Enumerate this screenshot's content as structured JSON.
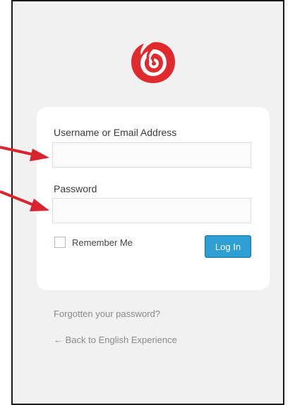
{
  "logo": {
    "icon": "rose-icon",
    "color": "#e02a2e"
  },
  "login_form": {
    "username_label": "Username or Email Address",
    "username_value": "",
    "password_label": "Password",
    "password_value": "",
    "remember_label": "Remember Me",
    "remember_checked": false,
    "submit_label": "Log In"
  },
  "links": {
    "lost_password": "Forgotten your password?",
    "back_to_site": "← Back to English Experience"
  },
  "colors": {
    "button": "#2e9fd2",
    "annotation_arrow": "#d9232f",
    "background": "#f1f1f1"
  }
}
